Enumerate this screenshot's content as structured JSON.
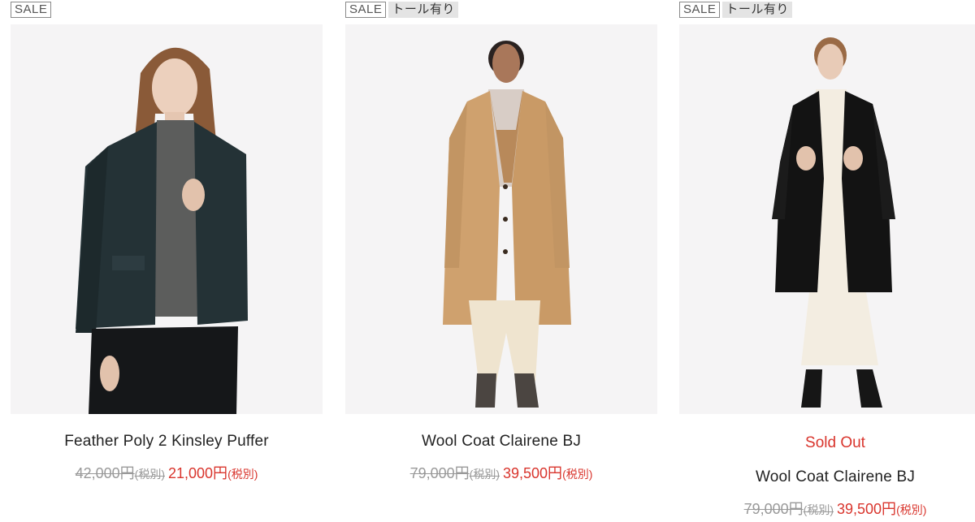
{
  "products": [
    {
      "badges": [
        "SALE"
      ],
      "name": "Feather Poly 2 Kinsley Puffer",
      "status": "",
      "original_price": "42,000円",
      "original_tax": "(税別)",
      "sale_price": "21,000円",
      "sale_tax": "(税別)"
    },
    {
      "badges": [
        "SALE",
        "トール有り"
      ],
      "name": "Wool Coat Clairene BJ",
      "status": "",
      "original_price": "79,000円",
      "original_tax": "(税別)",
      "sale_price": "39,500円",
      "sale_tax": "(税別)"
    },
    {
      "badges": [
        "SALE",
        "トール有り"
      ],
      "name": "Wool Coat Clairene BJ",
      "status": "Sold Out",
      "original_price": "79,000円",
      "original_tax": "(税別)",
      "sale_price": "39,500円",
      "sale_tax": "(税別)"
    }
  ],
  "colors": {
    "sale_red": "#d9352d",
    "strike_gray": "#999999",
    "photo_bg": "#f5f4f5",
    "tall_badge_bg": "#e4e4e4"
  }
}
